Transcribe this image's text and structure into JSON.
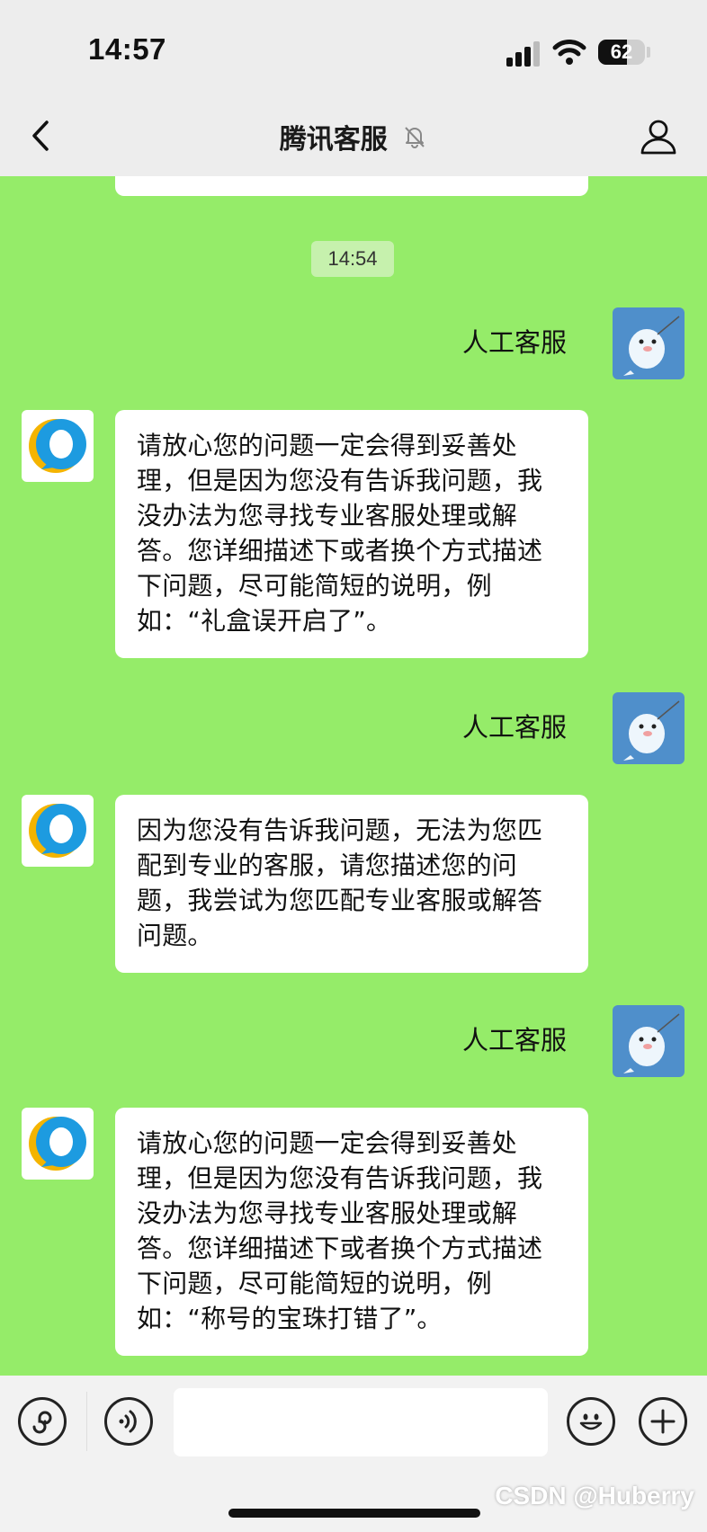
{
  "status_bar": {
    "time": "14:57",
    "battery_percent": "62",
    "battery_level": 0.62
  },
  "nav": {
    "title": "腾讯客服"
  },
  "chat": {
    "timestamp": "14:54",
    "user_messages": [
      "人工客服",
      "人工客服",
      "人工客服"
    ],
    "bot_messages": [
      "请放心您的问题一定会得到妥善处理，但是因为您没有告诉我问题，我没办法为您寻找专业客服处理或解答。您详细描述下或者换个方式描述下问题，尽可能简短的说明，例如：“礼盒误开启了”。",
      "因为您没有告诉我问题，无法为您匹配到专业的客服，请您描述您的问题，我尝试为您匹配专业客服或解答问题。",
      "请放心您的问题一定会得到妥善处理，但是因为您没有告诉我问题，我没办法为您寻找专业客服处理或解答。您详细描述下或者换个方式描述下问题，尽可能简短的说明，例如：“称号的宝珠打错了”。"
    ]
  },
  "input": {
    "value": "",
    "placeholder": ""
  },
  "icons": [
    "back-icon",
    "mute-bell-icon",
    "profile-icon",
    "mini-program-icon",
    "voice-icon",
    "emoji-icon",
    "plus-icon",
    "signal-icon",
    "wifi-icon",
    "battery-icon"
  ],
  "watermark": "CSDN @Huberry",
  "colors": {
    "chat_background": "#95ec69",
    "bar_background": "#ededed",
    "bubble": "#ffffff",
    "time_chip": "#c6f1ad"
  }
}
